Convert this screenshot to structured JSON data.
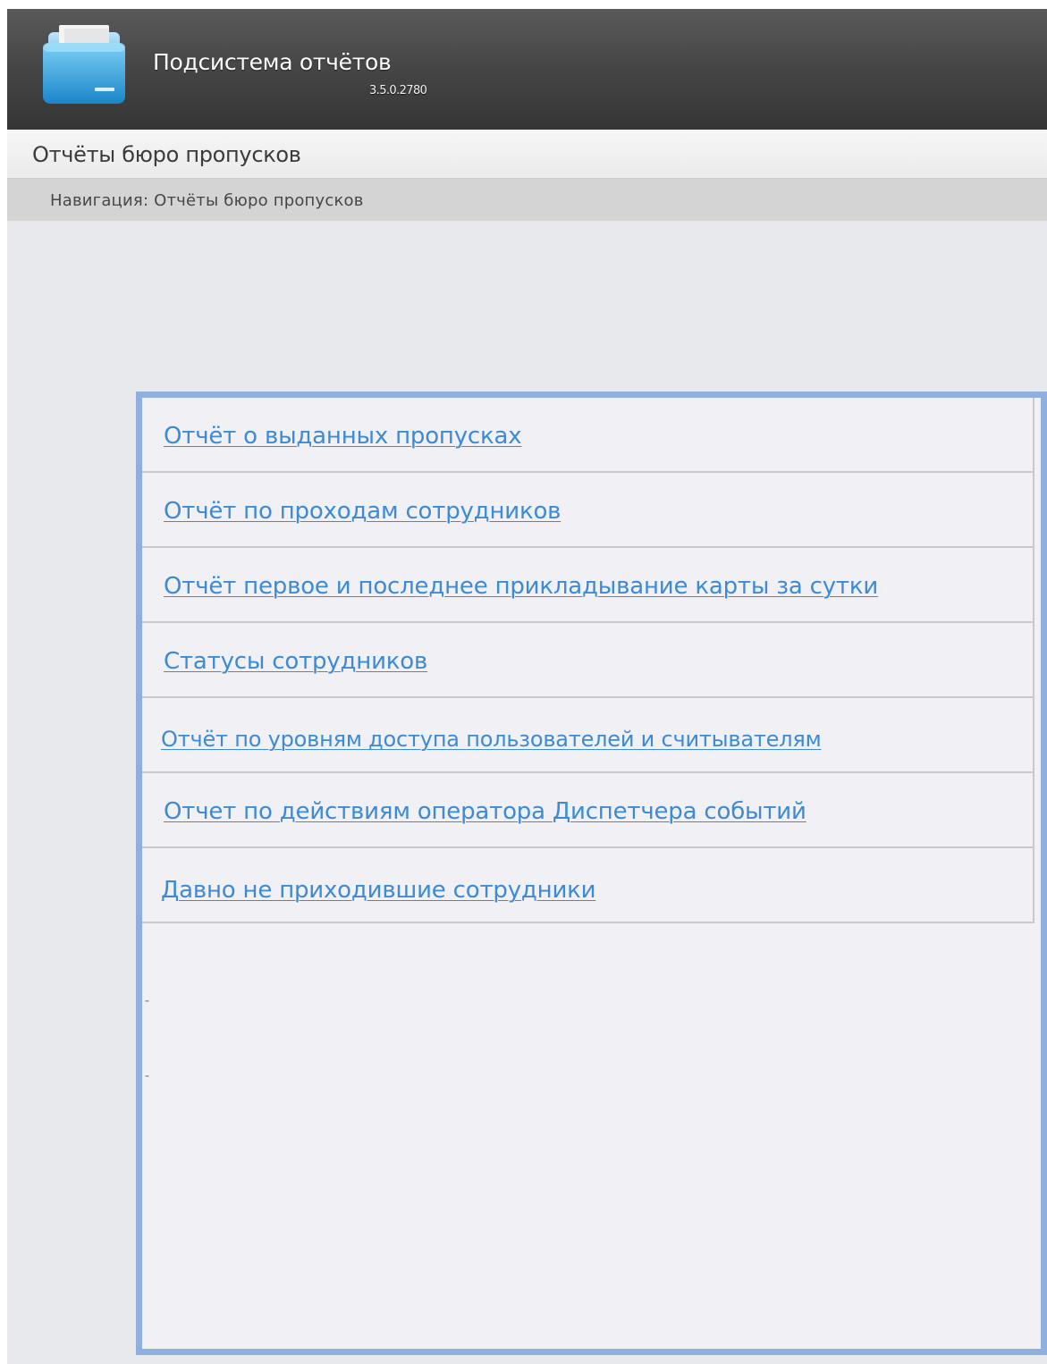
{
  "header": {
    "title": "Подсистема отчётов",
    "version": "3.5.0.2780"
  },
  "section": {
    "title": "Отчёты бюро пропусков"
  },
  "breadcrumb": {
    "label": "Навигация:",
    "current": "Отчёты бюро пропусков"
  },
  "reports": [
    {
      "label": "Отчёт о выданных пропусках"
    },
    {
      "label": "Отчёт по проходам сотрудников"
    },
    {
      "label": "Отчёт первое и последнее прикладывание карты за сутки"
    },
    {
      "label": "Статусы сотрудников"
    },
    {
      "label": "Отчёт по уровням доступа пользователей и считывателям"
    },
    {
      "label": "Отчет по действиям оператора Диспетчера событий"
    },
    {
      "label": "Давно не приходившие сотрудники"
    }
  ],
  "stray_marks": [
    "-",
    "-"
  ],
  "colors": {
    "link": "#3d8ad6",
    "panel_border": "#8fb0de",
    "header_bg": "#474747"
  }
}
